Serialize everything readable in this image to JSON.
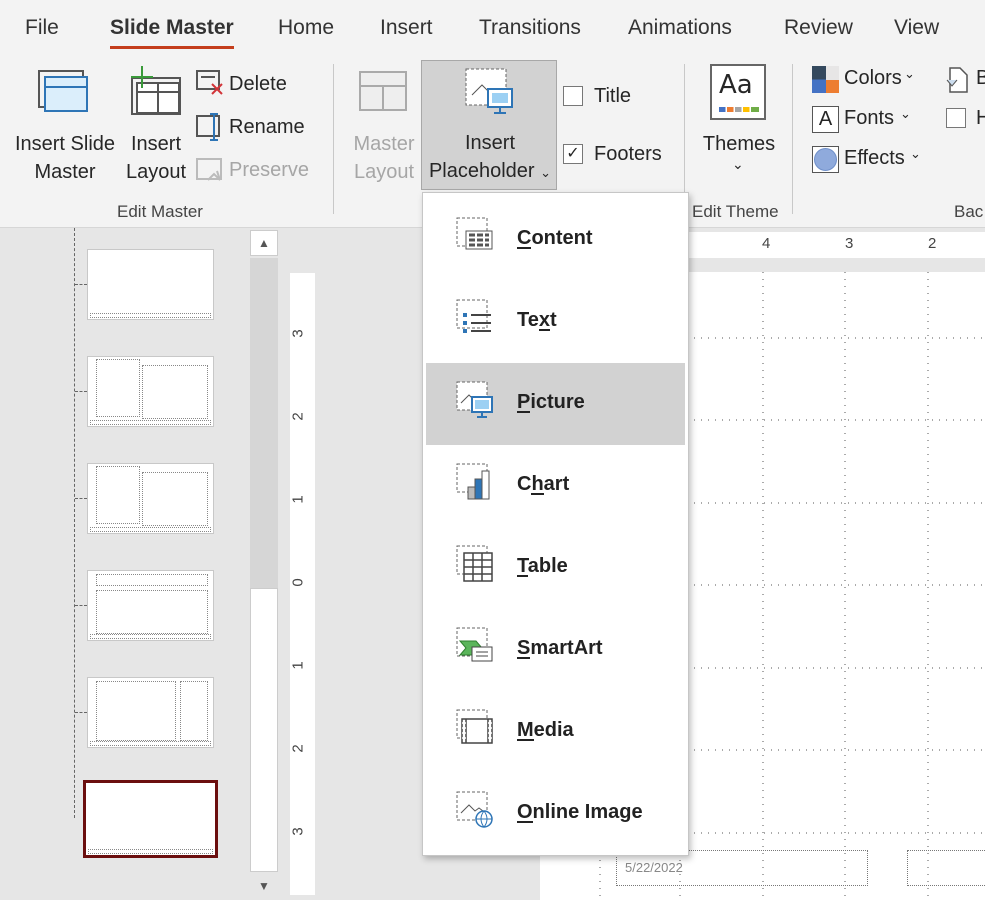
{
  "tabs": [
    "File",
    "Slide Master",
    "Home",
    "Insert",
    "Transitions",
    "Animations",
    "Review",
    "View"
  ],
  "active_tab": "Slide Master",
  "ribbon": {
    "insert_slide_master": [
      "Insert Slide",
      "Master"
    ],
    "insert_layout": [
      "Insert",
      "Layout"
    ],
    "delete": "Delete",
    "rename": "Rename",
    "preserve": "Preserve",
    "group_edit_master": "Edit Master",
    "master_layout": [
      "Master",
      "Layout"
    ],
    "insert_placeholder": [
      "Insert",
      "Placeholder"
    ],
    "title": "Title",
    "title_checked": false,
    "footers": "Footers",
    "footers_checked": true,
    "themes": "Themes",
    "group_edit_theme": "Edit Theme",
    "colors": "Colors",
    "fonts": "Fonts",
    "effects": "Effects",
    "background_styles_partial": "B",
    "hide_bg_partial": "H",
    "group_background_partial": "Bac"
  },
  "menu": {
    "items": [
      {
        "label": "Content",
        "key": 0,
        "icon": "content-placeholder-icon"
      },
      {
        "label": "Text",
        "key": 2,
        "icon": "text-placeholder-icon"
      },
      {
        "label": "Picture",
        "key": 0,
        "icon": "picture-placeholder-icon",
        "highlighted": true
      },
      {
        "label": "Chart",
        "key": 1,
        "icon": "chart-placeholder-icon"
      },
      {
        "label": "Table",
        "key": 0,
        "icon": "table-placeholder-icon"
      },
      {
        "label": "SmartArt",
        "key": 0,
        "icon": "smartart-placeholder-icon"
      },
      {
        "label": "Media",
        "key": 0,
        "icon": "media-placeholder-icon"
      },
      {
        "label": "Online Image",
        "key": 0,
        "icon": "online-image-placeholder-icon"
      }
    ]
  },
  "ruler": {
    "h": [
      "4",
      "3",
      "2"
    ],
    "v": [
      "3",
      "2",
      "1",
      "0",
      "1",
      "2",
      "3"
    ]
  },
  "slide": {
    "date": "5/22/2022"
  },
  "colors": {
    "accent": "#c43e1c",
    "selected_thumb": "#6b0e0e"
  }
}
